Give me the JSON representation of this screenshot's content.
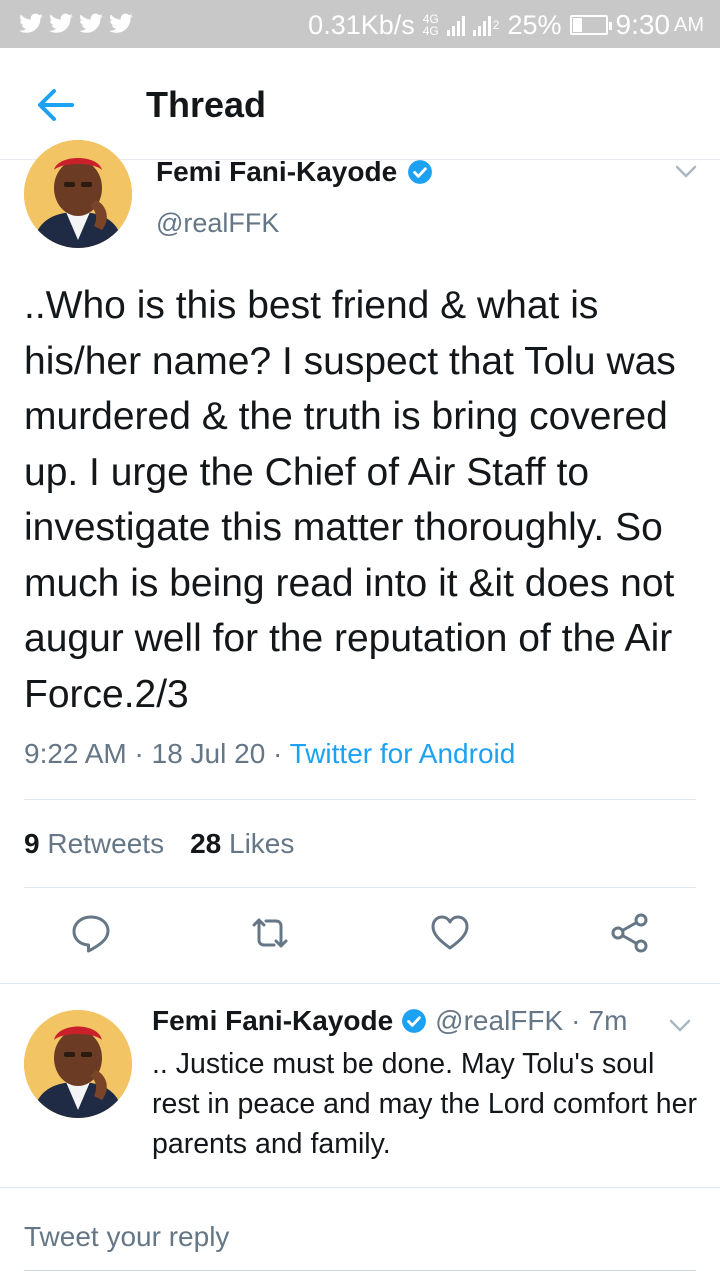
{
  "status_bar": {
    "speed": "0.31Kb/s",
    "net_top": "4G",
    "net_bottom": "4G",
    "sim2": "2",
    "battery": "25%",
    "battery_level": 0.25,
    "time": "9:30",
    "ampm": "AM"
  },
  "header": {
    "title": "Thread",
    "back_icon": "arrow-left-icon"
  },
  "main_tweet": {
    "name": "Femi Fani-Kayode",
    "handle": "@realFFK",
    "text": "..Who is this best friend & what is his/her name? I suspect that Tolu was murdered & the truth is bring covered up. I urge the Chief of Air Staff to investigate this matter thoroughly. So much is being read into it &it does not augur well for the reputation of the Air Force.2/3",
    "time": "9:22 AM",
    "sep": "·",
    "date": "18 Jul 20",
    "source": "Twitter for Android",
    "retweets_count": "9",
    "retweets_label": "Retweets",
    "likes_count": "28",
    "likes_label": "Likes"
  },
  "reply_tweet": {
    "name": "Femi Fani-Kayode",
    "handle": "@realFFK",
    "sep": "·",
    "age": "7m",
    "text": ".. Justice must be done. May Tolu's soul rest in peace and may the Lord comfort her parents and family."
  },
  "composer": {
    "placeholder": "Tweet your reply"
  },
  "colors": {
    "accent": "#1da1f2",
    "secondary_text": "#657786",
    "primary_text": "#14171a"
  }
}
